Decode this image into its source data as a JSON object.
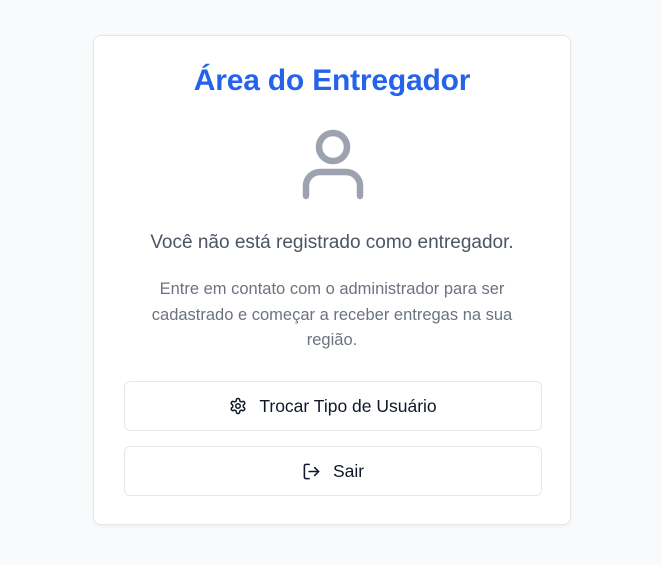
{
  "card": {
    "title": "Área do Entregador",
    "icon": "user-icon",
    "heading": "Você não está registrado como entregador.",
    "description": "Entre em contato com o administrador para ser cadastrado e começar a receber entregas na sua região."
  },
  "actions": {
    "switch_user_type": {
      "label": "Trocar Tipo de Usuário",
      "icon": "gear-icon"
    },
    "logout": {
      "label": "Sair",
      "icon": "logout-icon"
    }
  },
  "colors": {
    "accent": "#2563eb",
    "icon_gray": "#9ca3af",
    "text_primary": "#111827",
    "text_secondary": "#4b5563",
    "text_muted": "#6b7280",
    "background": "#f9fafb"
  }
}
